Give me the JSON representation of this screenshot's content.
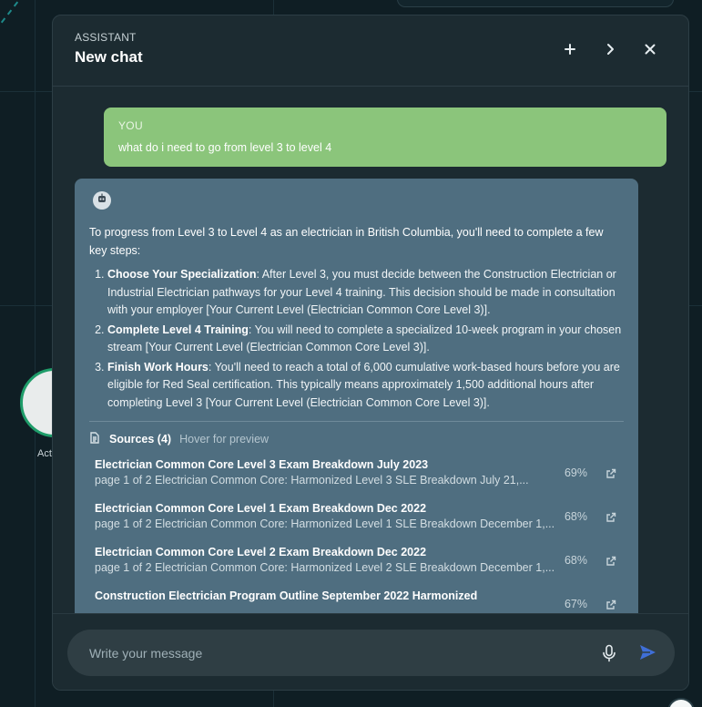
{
  "background": {
    "node_label": "Act"
  },
  "panel": {
    "kicker": "ASSISTANT",
    "title": "New chat",
    "header_buttons": [
      "plus-icon",
      "chevron-right-icon",
      "close-icon"
    ]
  },
  "conversation": {
    "user": {
      "role_label": "YOU",
      "text": "what do i need to go from level 3 to level 4"
    },
    "assistant": {
      "intro": "To progress from Level 3 to Level 4 as an electrician in British Columbia, you'll need to complete a few key steps:",
      "steps": [
        {
          "title": "Choose Your Specialization",
          "text": ": After Level 3, you must decide between the Construction Electrician or Industrial Electrician pathways for your Level 4 training. This decision should be made in consultation with your employer [Your Current Level (Electrician Common Core Level 3)]."
        },
        {
          "title": "Complete Level 4 Training",
          "text": ": You will need to complete a specialized 10-week program in your chosen stream [Your Current Level (Electrician Common Core Level 3)]."
        },
        {
          "title": "Finish Work Hours",
          "text": ": You'll need to reach a total of 6,000 cumulative work-based hours before you are eligible for Red Seal certification. This typically means approximately 1,500 additional hours after completing Level 3 [Your Current Level (Electrician Common Core Level 3)]."
        }
      ],
      "sources_label": "Sources (4)",
      "sources_hint": "Hover for preview",
      "sources": [
        {
          "title": "Electrician Common Core Level 3 Exam Breakdown July 2023",
          "snippet": "page 1 of 2 Electrician Common Core: Harmonized Level 3 SLE Breakdown July 21,...",
          "score": "69%"
        },
        {
          "title": "Electrician Common Core Level 1 Exam Breakdown Dec 2022",
          "snippet": "page 1 of 2 Electrician Common Core: Harmonized Level 1 SLE Breakdown December 1,...",
          "score": "68%"
        },
        {
          "title": "Electrician Common Core Level 2 Exam Breakdown Dec 2022",
          "snippet": "page 1 of 2 Electrician Common Core: Harmonized Level 2 SLE Breakdown December 1,...",
          "score": "68%"
        },
        {
          "title": "Construction Electrician Program Outline September 2022 Harmonized",
          "snippet": "",
          "score": "67%"
        }
      ]
    }
  },
  "composer": {
    "placeholder": "Write your message"
  },
  "colors": {
    "user_bubble": "#8bc57b",
    "assistant_bubble": "#4f6e80",
    "panel_bg": "#1c2b31",
    "send_accent": "#3f6fd8"
  }
}
